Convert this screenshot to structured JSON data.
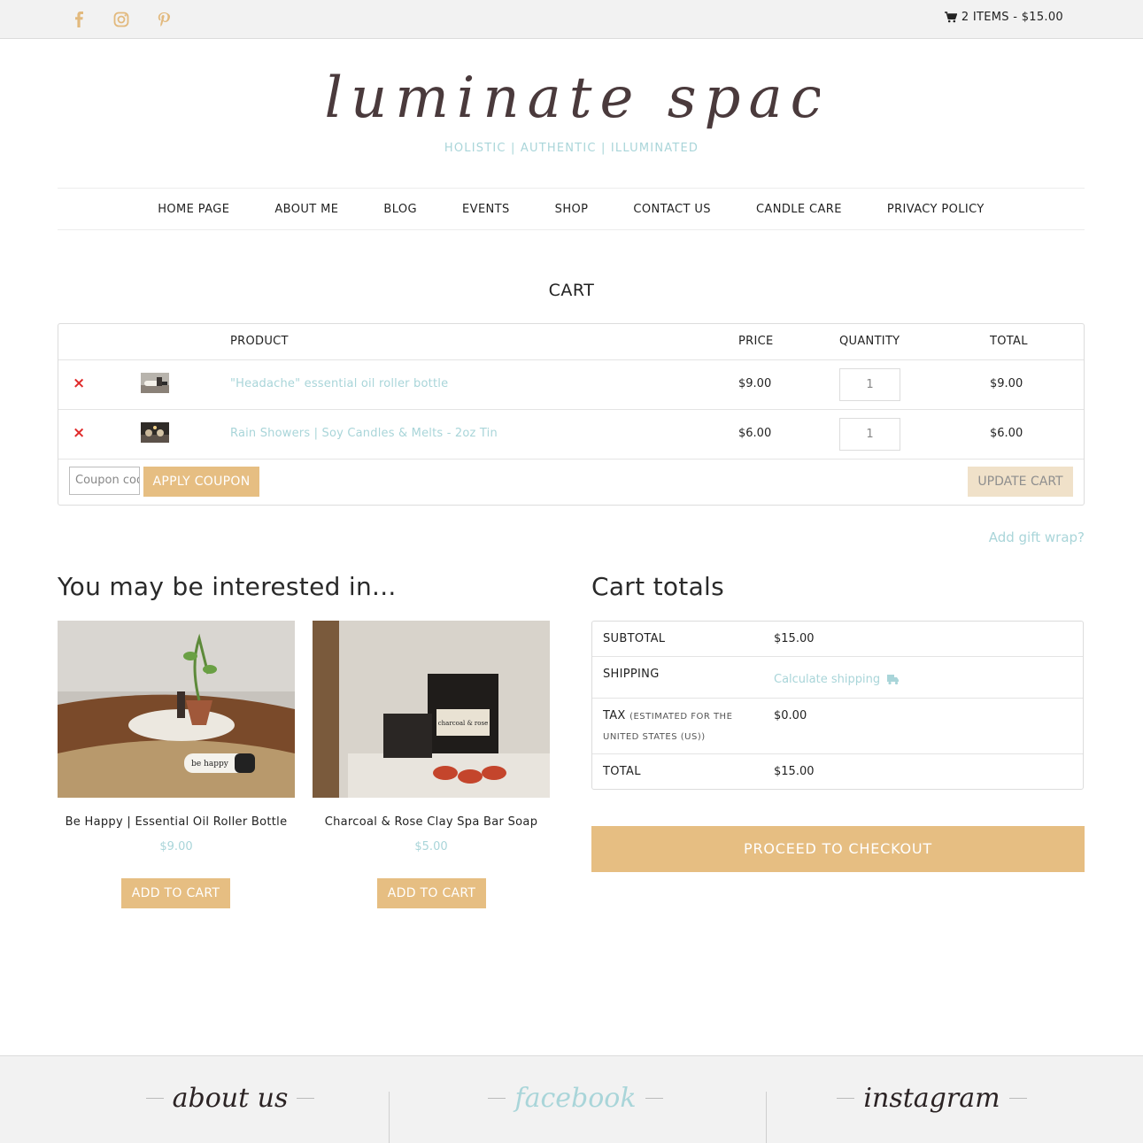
{
  "topbar": {
    "social": [
      {
        "name": "facebook-icon"
      },
      {
        "name": "instagram-icon"
      },
      {
        "name": "pinterest-icon"
      }
    ],
    "cart_summary": "2 ITEMS - $15.00"
  },
  "brand": {
    "logo_text": "illuminate space",
    "tagline": "HOLISTIC | AUTHENTIC | ILLUMINATED"
  },
  "nav": [
    "HOME PAGE",
    "ABOUT ME",
    "BLOG",
    "EVENTS",
    "SHOP",
    "CONTACT US",
    "CANDLE CARE",
    "PRIVACY POLICY"
  ],
  "page_title": "CART",
  "cart": {
    "headers": {
      "product": "PRODUCT",
      "price": "PRICE",
      "quantity": "QUANTITY",
      "total": "TOTAL"
    },
    "items": [
      {
        "name": "\"Headache\" essential oil roller bottle",
        "price": "$9.00",
        "quantity": "1",
        "total": "$9.00"
      },
      {
        "name": "Rain Showers | Soy Candles & Melts - 2oz Tin",
        "price": "$6.00",
        "quantity": "1",
        "total": "$6.00"
      }
    ],
    "remove_symbol": "×",
    "coupon_placeholder": "Coupon code",
    "apply_coupon": "APPLY COUPON",
    "update_cart": "UPDATE CART",
    "gift_wrap": "Add gift wrap?"
  },
  "cross_sells": {
    "heading": "You may be interested in...",
    "products": [
      {
        "name": "Be Happy | Essential Oil Roller Bottle",
        "price": "$9.00",
        "button": "ADD TO CART",
        "image_text": "be happy"
      },
      {
        "name": "Charcoal & Rose Clay Spa Bar Soap",
        "price": "$5.00",
        "button": "ADD TO CART",
        "image_text": "charcoal & rose"
      }
    ]
  },
  "totals": {
    "heading": "Cart totals",
    "subtotal_label": "SUBTOTAL",
    "subtotal": "$15.00",
    "shipping_label": "SHIPPING",
    "shipping_link": "Calculate shipping",
    "tax_label": "TAX",
    "tax_note": "(ESTIMATED FOR THE UNITED STATES (US))",
    "tax": "$0.00",
    "total_label": "TOTAL",
    "total": "$15.00",
    "checkout": "PROCEED TO CHECKOUT"
  },
  "footer": {
    "columns": [
      "about us",
      "facebook",
      "instagram"
    ]
  },
  "colors": {
    "accent_gold": "#e6be82",
    "accent_teal": "#a9d5d9",
    "remove_red": "#e02b2b",
    "logo_brown": "#4a3a3c"
  }
}
